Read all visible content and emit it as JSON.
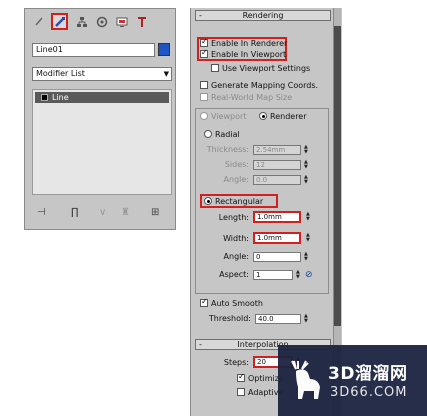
{
  "left_panel": {
    "tabs": [
      "create-icon",
      "modify-icon",
      "hierarchy-icon",
      "motion-icon",
      "display-icon",
      "utilities-icon"
    ],
    "object_name": "Line01",
    "modifier_list": "Modifier List",
    "stack_item": "Line"
  },
  "rendering": {
    "title": "Rendering",
    "pm": "-",
    "enable_renderer": "Enable In Renderer",
    "enable_viewport": "Enable In Viewport",
    "use_viewport_settings": "Use Viewport Settings",
    "generate_mapping": "Generate Mapping Coords.",
    "real_world": "Real-World Map Size",
    "viewport_label": "Viewport",
    "renderer_label": "Renderer",
    "radial": "Radial",
    "thickness_label": "Thickness:",
    "thickness_value": "2.54mm",
    "sides_label": "Sides:",
    "sides_value": "12",
    "angle_label": "Angle:",
    "angle_value": "0.0",
    "rectangular": "Rectangular",
    "length_label": "Length:",
    "length_value": "1.0mm",
    "width_label": "Width:",
    "width_value": "1.0mm",
    "angle2_label": "Angle:",
    "angle2_value": "0",
    "aspect_label": "Aspect:",
    "aspect_value": "1",
    "auto_smooth": "Auto Smooth",
    "threshold_label": "Threshold:",
    "threshold_value": "40.0"
  },
  "interpolation": {
    "title": "Interpolation",
    "steps_label": "Steps:",
    "steps_value": "20",
    "optimize": "Optimize",
    "adaptive": "Adaptive"
  },
  "watermark": {
    "title": "3D溜溜网",
    "subtitle": "3D66.COM"
  },
  "colors": {
    "highlight": "#d21f1f",
    "panel": "#c6c6c6",
    "swatch": "#1b56c4"
  }
}
